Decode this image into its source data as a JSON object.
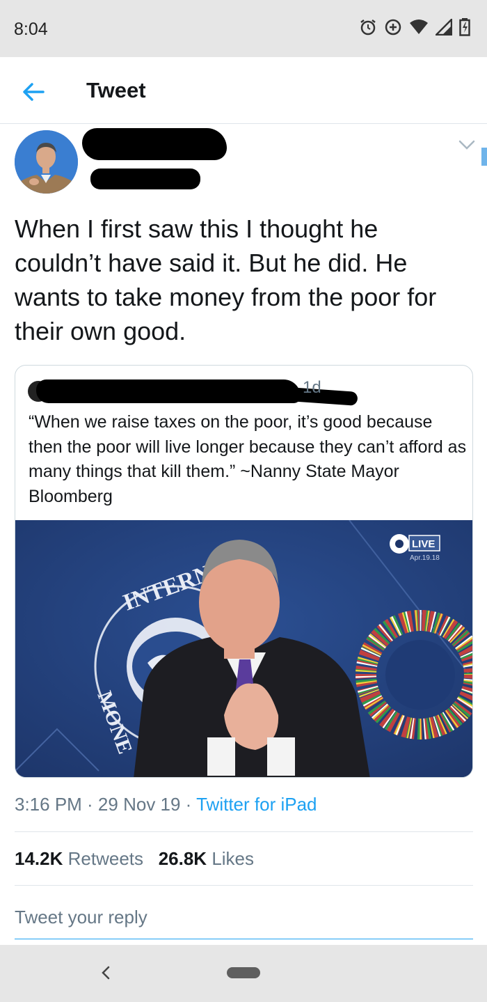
{
  "status_bar": {
    "time": "8:04",
    "icons": [
      "alarm-icon",
      "data-saver-icon",
      "wifi-icon",
      "signal-icon",
      "battery-icon"
    ]
  },
  "header": {
    "title": "Tweet",
    "back_icon": "back-arrow-icon"
  },
  "tweet": {
    "text": "When I first saw this I thought he couldn’t have said it. But he did. He wants to take money from the poor for their own good.",
    "timestamp": "3:16 PM · 29 Nov 19 · ",
    "source": "Twitter for iPad",
    "retweets_count": "14.2K",
    "retweets_label": "Retweets",
    "likes_count": "26.8K",
    "likes_label": "Likes"
  },
  "quoted_tweet": {
    "time": "1d",
    "text": "“When we raise taxes on the poor, it’s good because then the poor will live longer because they can’t afford as many things that kill them.” ~Nanny State Mayor Bloomberg",
    "image": {
      "live_badge": "LIVE",
      "date": "Apr.19.18",
      "seal_text": "INTERNAT",
      "seal_text_lower": "MONE"
    }
  },
  "reply": {
    "placeholder": "Tweet your reply"
  },
  "colors": {
    "link": "#1da1f2",
    "secondary_text": "#657786",
    "status_bar": "#e6e6e6"
  }
}
